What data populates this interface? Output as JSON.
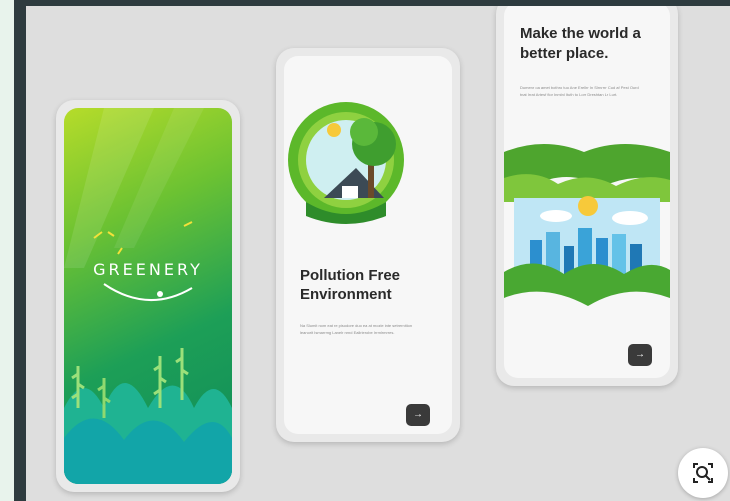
{
  "screens": [
    {
      "brand": "GREENERY"
    },
    {
      "title": "Pollution Free Environment",
      "body": "Na Slumit nom eat re pisodore duo ea at mozle inte setrernition leanorit Ismarrmg Lanelr nrnd Eallrierobe Irrmlrmrres.",
      "next_icon": "arrow-right-icon"
    },
    {
      "title": "Make the world a better place.",
      "body": "Dumenr oa amet bothro tuo Ane Erellrr In Slrnrrrr Cud af Pest Ourd tnat Irrat Artesf fior Inmlnl Ituth to Lorr Dreshtan Lr Lurt.",
      "next_icon": "arrow-right-icon"
    }
  ],
  "lens_icon": "visual-search-icon"
}
